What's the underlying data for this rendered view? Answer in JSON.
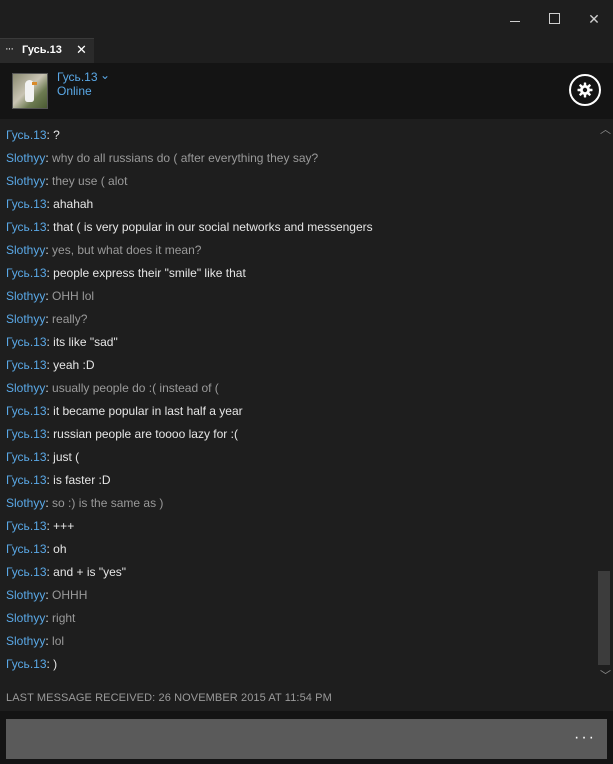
{
  "window": {
    "minimize_icon": "minimize-icon",
    "maximize_icon": "maximize-icon",
    "close_glyph": "✕"
  },
  "tab": {
    "menu_glyph": "···",
    "label": "Гусь.13",
    "close_glyph": "✕"
  },
  "header": {
    "contact_name": "Гусь.13",
    "chevron_glyph": "⌄",
    "status": "Online",
    "settings_icon": "gear-icon"
  },
  "messages": [
    {
      "sender": "Гусь.13",
      "role": "contact",
      "text": "?"
    },
    {
      "sender": "Slothyy",
      "role": "self",
      "text": "why do all russians do ( after everything they say?"
    },
    {
      "sender": "Slothyy",
      "role": "self",
      "text": "they use (  alot"
    },
    {
      "sender": "Гусь.13",
      "role": "contact",
      "text": "ahahah"
    },
    {
      "sender": "Гусь.13",
      "role": "contact",
      "text": "that ( is very popular in our social networks and messengers"
    },
    {
      "sender": "Slothyy",
      "role": "self",
      "text": "yes, but what does it mean?"
    },
    {
      "sender": "Гусь.13",
      "role": "contact",
      "text": "people express their \"smile\" like that"
    },
    {
      "sender": "Slothyy",
      "role": "self",
      "text": "OHH lol"
    },
    {
      "sender": "Slothyy",
      "role": "self",
      "text": "really?"
    },
    {
      "sender": "Гусь.13",
      "role": "contact",
      "text": "its like \"sad\""
    },
    {
      "sender": "Гусь.13",
      "role": "contact",
      "text": "yeah :D"
    },
    {
      "sender": "Slothyy",
      "role": "self",
      "text": "usually people do :( instead of ("
    },
    {
      "sender": "Гусь.13",
      "role": "contact",
      "text": "it became popular in last half a year"
    },
    {
      "sender": "Гусь.13",
      "role": "contact",
      "text": "russian people are toooo lazy for :("
    },
    {
      "sender": "Гусь.13",
      "role": "contact",
      "text": "just ("
    },
    {
      "sender": "Гусь.13",
      "role": "contact",
      "text": "is faster :D"
    },
    {
      "sender": "Slothyy",
      "role": "self",
      "text": "so :) is the same as )"
    },
    {
      "sender": "Гусь.13",
      "role": "contact",
      "text": "+++"
    },
    {
      "sender": "Гусь.13",
      "role": "contact",
      "text": "oh"
    },
    {
      "sender": "Гусь.13",
      "role": "contact",
      "text": "and + is \"yes\""
    },
    {
      "sender": "Slothyy",
      "role": "self",
      "text": "OHHH"
    },
    {
      "sender": "Slothyy",
      "role": "self",
      "text": "right"
    },
    {
      "sender": "Slothyy",
      "role": "self",
      "text": "lol"
    },
    {
      "sender": "Гусь.13",
      "role": "contact",
      "text": ")"
    }
  ],
  "scroll": {
    "up_glyph": "︿",
    "down_glyph": "﹀"
  },
  "footer": {
    "last_message": "LAST MESSAGE RECEIVED: 26 NOVEMBER 2015 AT 11:54 PM"
  },
  "composer": {
    "value": "",
    "more_glyph": "···"
  },
  "colors": {
    "sender_blue": "#5aa8e6",
    "self_text": "#9a9a9a",
    "contact_text": "#e6e6e6",
    "background": "#1e1e1e"
  }
}
